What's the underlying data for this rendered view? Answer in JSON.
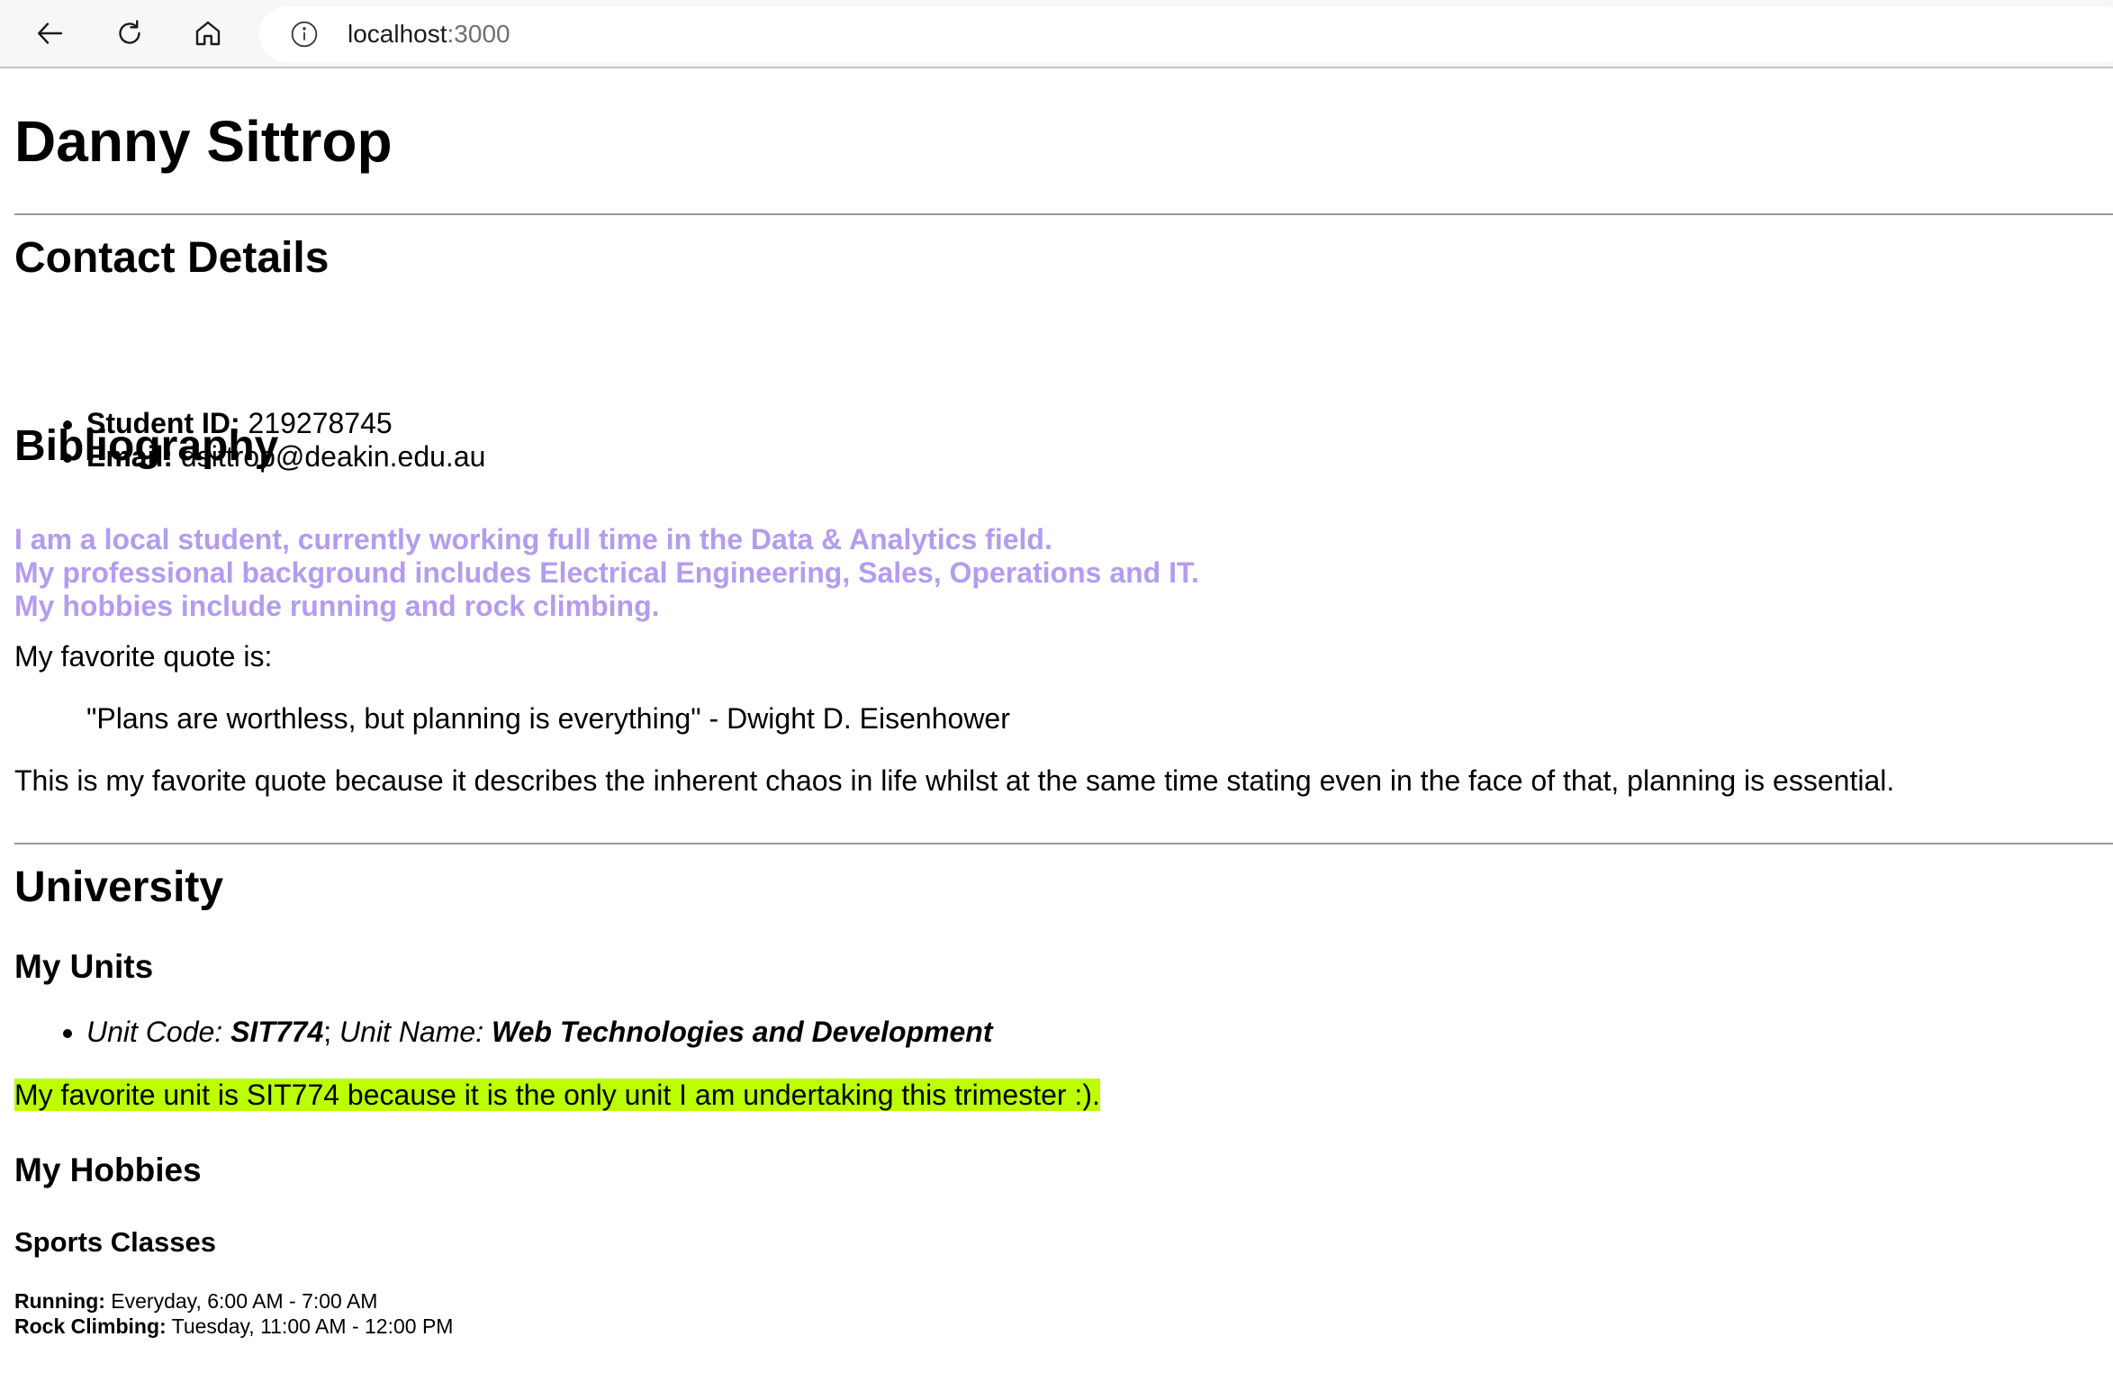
{
  "browser": {
    "address_host": "localhost",
    "address_port": ":3000",
    "back_icon": "back-arrow-icon",
    "reload_icon": "reload-icon",
    "home_icon": "home-icon",
    "site_info_icon": "info-icon"
  },
  "header": {
    "name": "Danny Sittrop"
  },
  "contact": {
    "heading": "Contact Details",
    "student_id_label": "Student ID:",
    "student_id_value": "219278745",
    "email_label": "Email:",
    "email_value": "dsittrop@deakin.edu.au"
  },
  "bibliography": {
    "heading": "Bibliography",
    "lines": [
      "I am a local student, currently working full time in the Data & Analytics field.",
      "My professional background includes Electrical Engineering, Sales, Operations and IT.",
      "My hobbies include running and rock climbing."
    ],
    "bio_color": "#b39cf0",
    "quote_intro": "My favorite quote is:",
    "quote": "\"Plans are worthless, but planning is everything\" - Dwight D. Eisenhower",
    "quote_reason": "This is my favorite quote because it describes the inherent chaos in life whilst at the same time stating even in the face of that, planning is essential."
  },
  "university": {
    "heading": "University",
    "units_heading": "My Units",
    "unit_code_label": "Unit Code:",
    "unit_code": "SIT774",
    "unit_separator": ";",
    "unit_name_label": "Unit Name:",
    "unit_name": "Web Technologies and Development",
    "favorite_unit": "My favorite unit is SIT774 because it is the only unit I am undertaking this trimester :).",
    "highlight_color": "#bbff00",
    "hobbies_heading": "My Hobbies",
    "sports_heading": "Sports Classes",
    "classes": [
      {
        "label": "Running:",
        "value": "Everyday, 6:00 AM - 7:00 AM"
      },
      {
        "label": "Rock Climbing:",
        "value": "Tuesday, 11:00 AM - 12:00 PM"
      }
    ]
  }
}
